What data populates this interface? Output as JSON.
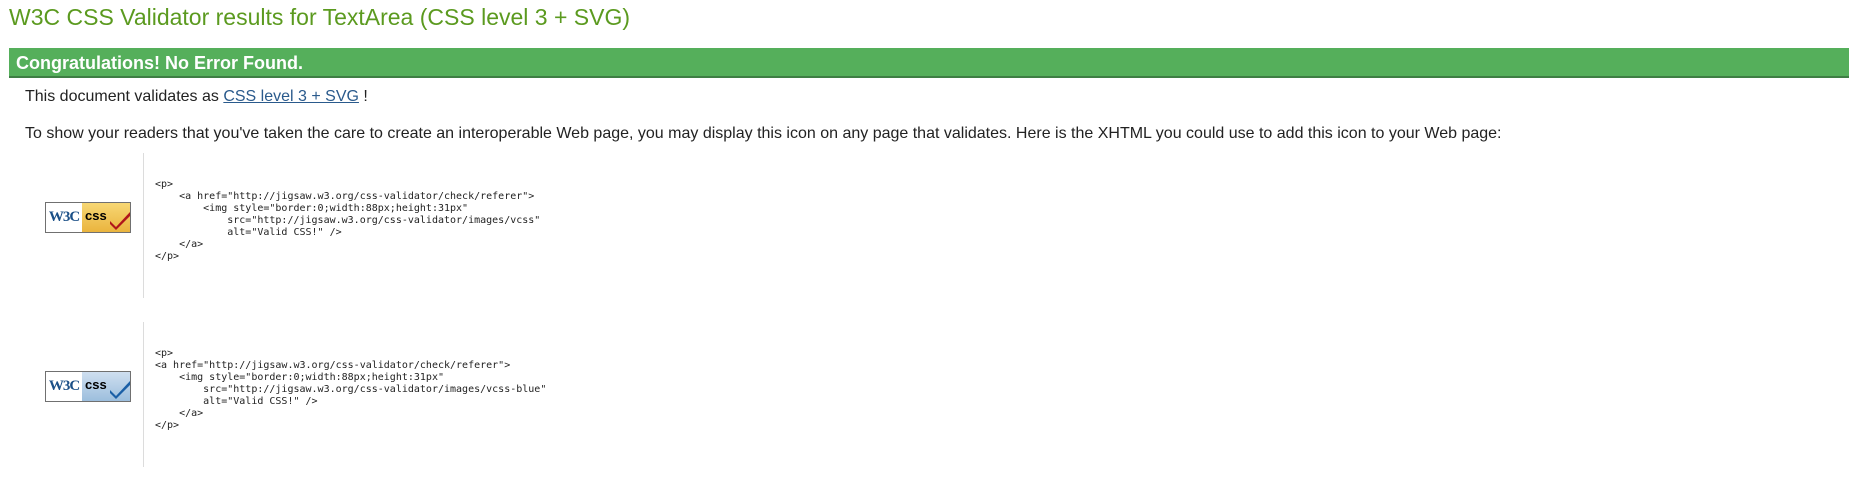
{
  "header": {
    "title": "W3C CSS Validator results for TextArea (CSS level 3 + SVG)"
  },
  "result": {
    "banner": "Congratulations! No Error Found.",
    "validates_prefix": "This document validates as ",
    "profile_link": "CSS level 3 + SVG",
    "validates_suffix": " !",
    "readers_text": "To show your readers that you've taken the care to create an interoperable Web page, you may display this icon on any page that validates. Here is the XHTML you could use to add this icon to your Web page:"
  },
  "badges": [
    {
      "w3c_text": "W3C",
      "css_text": "css",
      "check_color": "#b0161b",
      "icon": "w3c-css-valid-gold-icon",
      "code": "<p>\n    <a href=\"http://jigsaw.w3.org/css-validator/check/referer\">\n        <img style=\"border:0;width:88px;height:31px\"\n            src=\"http://jigsaw.w3.org/css-validator/images/vcss\"\n            alt=\"Valid CSS!\" />\n    </a>\n</p>"
    },
    {
      "w3c_text": "W3C",
      "css_text": "css",
      "check_color": "#1a5fa6",
      "icon": "w3c-css-valid-blue-icon",
      "code": "<p>\n<a href=\"http://jigsaw.w3.org/css-validator/check/referer\">\n    <img style=\"border:0;width:88px;height:31px\"\n        src=\"http://jigsaw.w3.org/css-validator/images/vcss-blue\"\n        alt=\"Valid CSS!\" />\n    </a>\n</p>"
    }
  ],
  "colors": {
    "title": "#5b9a1f",
    "banner_bg": "#55af5b",
    "link": "#2a5a8c"
  }
}
